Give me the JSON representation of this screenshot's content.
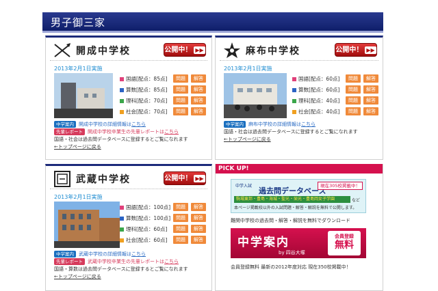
{
  "banner": {
    "title": "男子御三家"
  },
  "subjects_labels": {
    "question": "問題",
    "answer": "解答"
  },
  "schools": [
    {
      "name": "開成中学校",
      "open_label": "公開中！",
      "date": "2013年2月1日実施",
      "subjects": [
        {
          "label": "国語[配点：85点]",
          "color": "#e0407a"
        },
        {
          "label": "算数[配点：85点]",
          "color": "#2b63c4"
        },
        {
          "label": "理科[配点：70点]",
          "color": "#3aa64a"
        },
        {
          "label": "社会[配点：70点]",
          "color": "#f0a020"
        }
      ],
      "info_tag": "中学案内",
      "info_text": "開成中学校の詳細情報は",
      "info_link": "こちら",
      "report_tag": "先輩レポート",
      "report_text": "開成中学校卒業生の先輩レポートは",
      "report_link": "こちら",
      "note": "国語・社会は過去問データベースに登録するとご覧になれます",
      "top_link": "←トップページに戻る"
    },
    {
      "name": "麻布中学校",
      "open_label": "公開中！",
      "date": "2013年2月1日実施",
      "subjects": [
        {
          "label": "国語[配点：60点]",
          "color": "#e0407a"
        },
        {
          "label": "算数[配点：60点]",
          "color": "#2b63c4"
        },
        {
          "label": "理科[配点：40点]",
          "color": "#3aa64a"
        },
        {
          "label": "社会[配点：40点]",
          "color": "#f0a020"
        }
      ],
      "info_tag": "中学案内",
      "info_text": "麻布中学校の詳細情報は",
      "info_link": "こちら",
      "note": "国語・社会は過去問データベースに登録するとご覧になれます",
      "top_link": "←トップページに戻る"
    },
    {
      "name": "武蔵中学校",
      "open_label": "公開中！",
      "date": "2013年2月1日実施",
      "subjects": [
        {
          "label": "国語[配点：100点]",
          "color": "#e0407a"
        },
        {
          "label": "算数[配点：100点]",
          "color": "#2b63c4"
        },
        {
          "label": "理科[配点：60点]",
          "color": "#3aa64a"
        },
        {
          "label": "社会[配点：60点]",
          "color": "#f0a020"
        }
      ],
      "info_tag": "中学案内",
      "info_text": "武蔵中学校の詳細情報は",
      "info_link": "こちら",
      "report_tag": "先輩レポート",
      "report_text": "武蔵中学校卒業生の先輩レポートは",
      "report_link": "こちら",
      "note": "国語・算数は過去問データベースに登録するとご覧になれます",
      "top_link": "←トップページに戻る"
    }
  ],
  "pickup": {
    "header": "PICK UP!",
    "ad1_small": "中学入試",
    "ad1_title": "過去問データベース",
    "ad1_badge": "現在305校掲載中！",
    "ad1_schools": "駒場東邦・豊島・海城・聖光・栄光・豊島岡女子学園",
    "ad1_tail": "など",
    "ad1_sub": "本ページ掲載校以外の入試問題・解答・解説を無料で公開します。",
    "ad1_caption": "難関中学校の過去問・解答・解説を無料でダウンロード",
    "ad2_title": "中学案内",
    "ad2_by": "by 四谷大塚",
    "ad2_badge_top": "会員登録",
    "ad2_badge_big": "無料",
    "ad2_caption": "会員登録無料 最新の2012年度対応 現在350校掲載中！"
  }
}
